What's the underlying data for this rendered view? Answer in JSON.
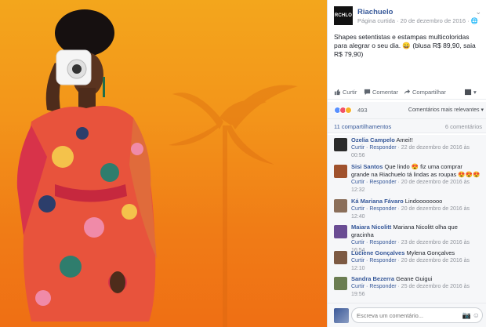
{
  "post": {
    "page_name": "Riachuelo",
    "logo_text": "RCHLO",
    "meta": "Página curtida · 20 de dezembro de 2016 ·",
    "more": "⌄",
    "caption": "Shapes setentistas e estampas multicoloridas para alegrar o seu dia. 😄 (blusa R$ 89,90, saia R$ 79,90)"
  },
  "actions": {
    "like": "Curtir",
    "comment": "Comentar",
    "share": "Compartilhar",
    "share_as": "▾"
  },
  "reactions": {
    "count": "493",
    "relevance": "Comentários mais relevantes ▾",
    "colors": [
      "#5890ff",
      "#f25268",
      "#f7b125"
    ]
  },
  "stats": {
    "shares": "11 compartilhamentos",
    "comments": "6 comentários"
  },
  "comments": [
    {
      "name": "Ozelia Campelo",
      "text": " Amei!!",
      "meta_actions": "Curtir · Responder",
      "time": " · 22 de dezembro de 2016 às 00:56",
      "avatar": "#2b2b2b"
    },
    {
      "name": "Sisi Santos",
      "text": " Que lindo 😍 fiz uma comprar grande na Riachuelo tá lindas as roupas 😍😍😍",
      "meta_actions": "Curtir · Responder",
      "time": " · 20 de dezembro de 2016 às 12:32",
      "avatar": "#a0522d"
    },
    {
      "name": "Ká Mariana Fávaro",
      "text": " Lindoooooooo",
      "meta_actions": "Curtir · Responder",
      "time": " · 20 de dezembro de 2016 às 12:40",
      "avatar": "#8b6f5a"
    },
    {
      "name": "Maiara Nicolitt",
      "text": " Mariana Nicolitt olha que gracinha",
      "meta_actions": "Curtir · Responder",
      "time": " · 23 de dezembro de 2016 às 16:54",
      "avatar": "#6a4c93"
    },
    {
      "name": "Luciene Gonçalves",
      "text": " Mylena Gonçalves",
      "meta_actions": "Curtir · Responder",
      "time": " · 20 de dezembro de 2016 às 12:10",
      "avatar": "#7d5a43"
    },
    {
      "name": "Sandra Bezerra",
      "text": " Geane Guigui",
      "meta_actions": "Curtir · Responder",
      "time": " · 25 de dezembro de 2016 às 19:56",
      "avatar": "#6b7d52"
    }
  ],
  "composer": {
    "placeholder": "Escreva um comentário...",
    "camera": "📷",
    "emoji": "☺"
  }
}
